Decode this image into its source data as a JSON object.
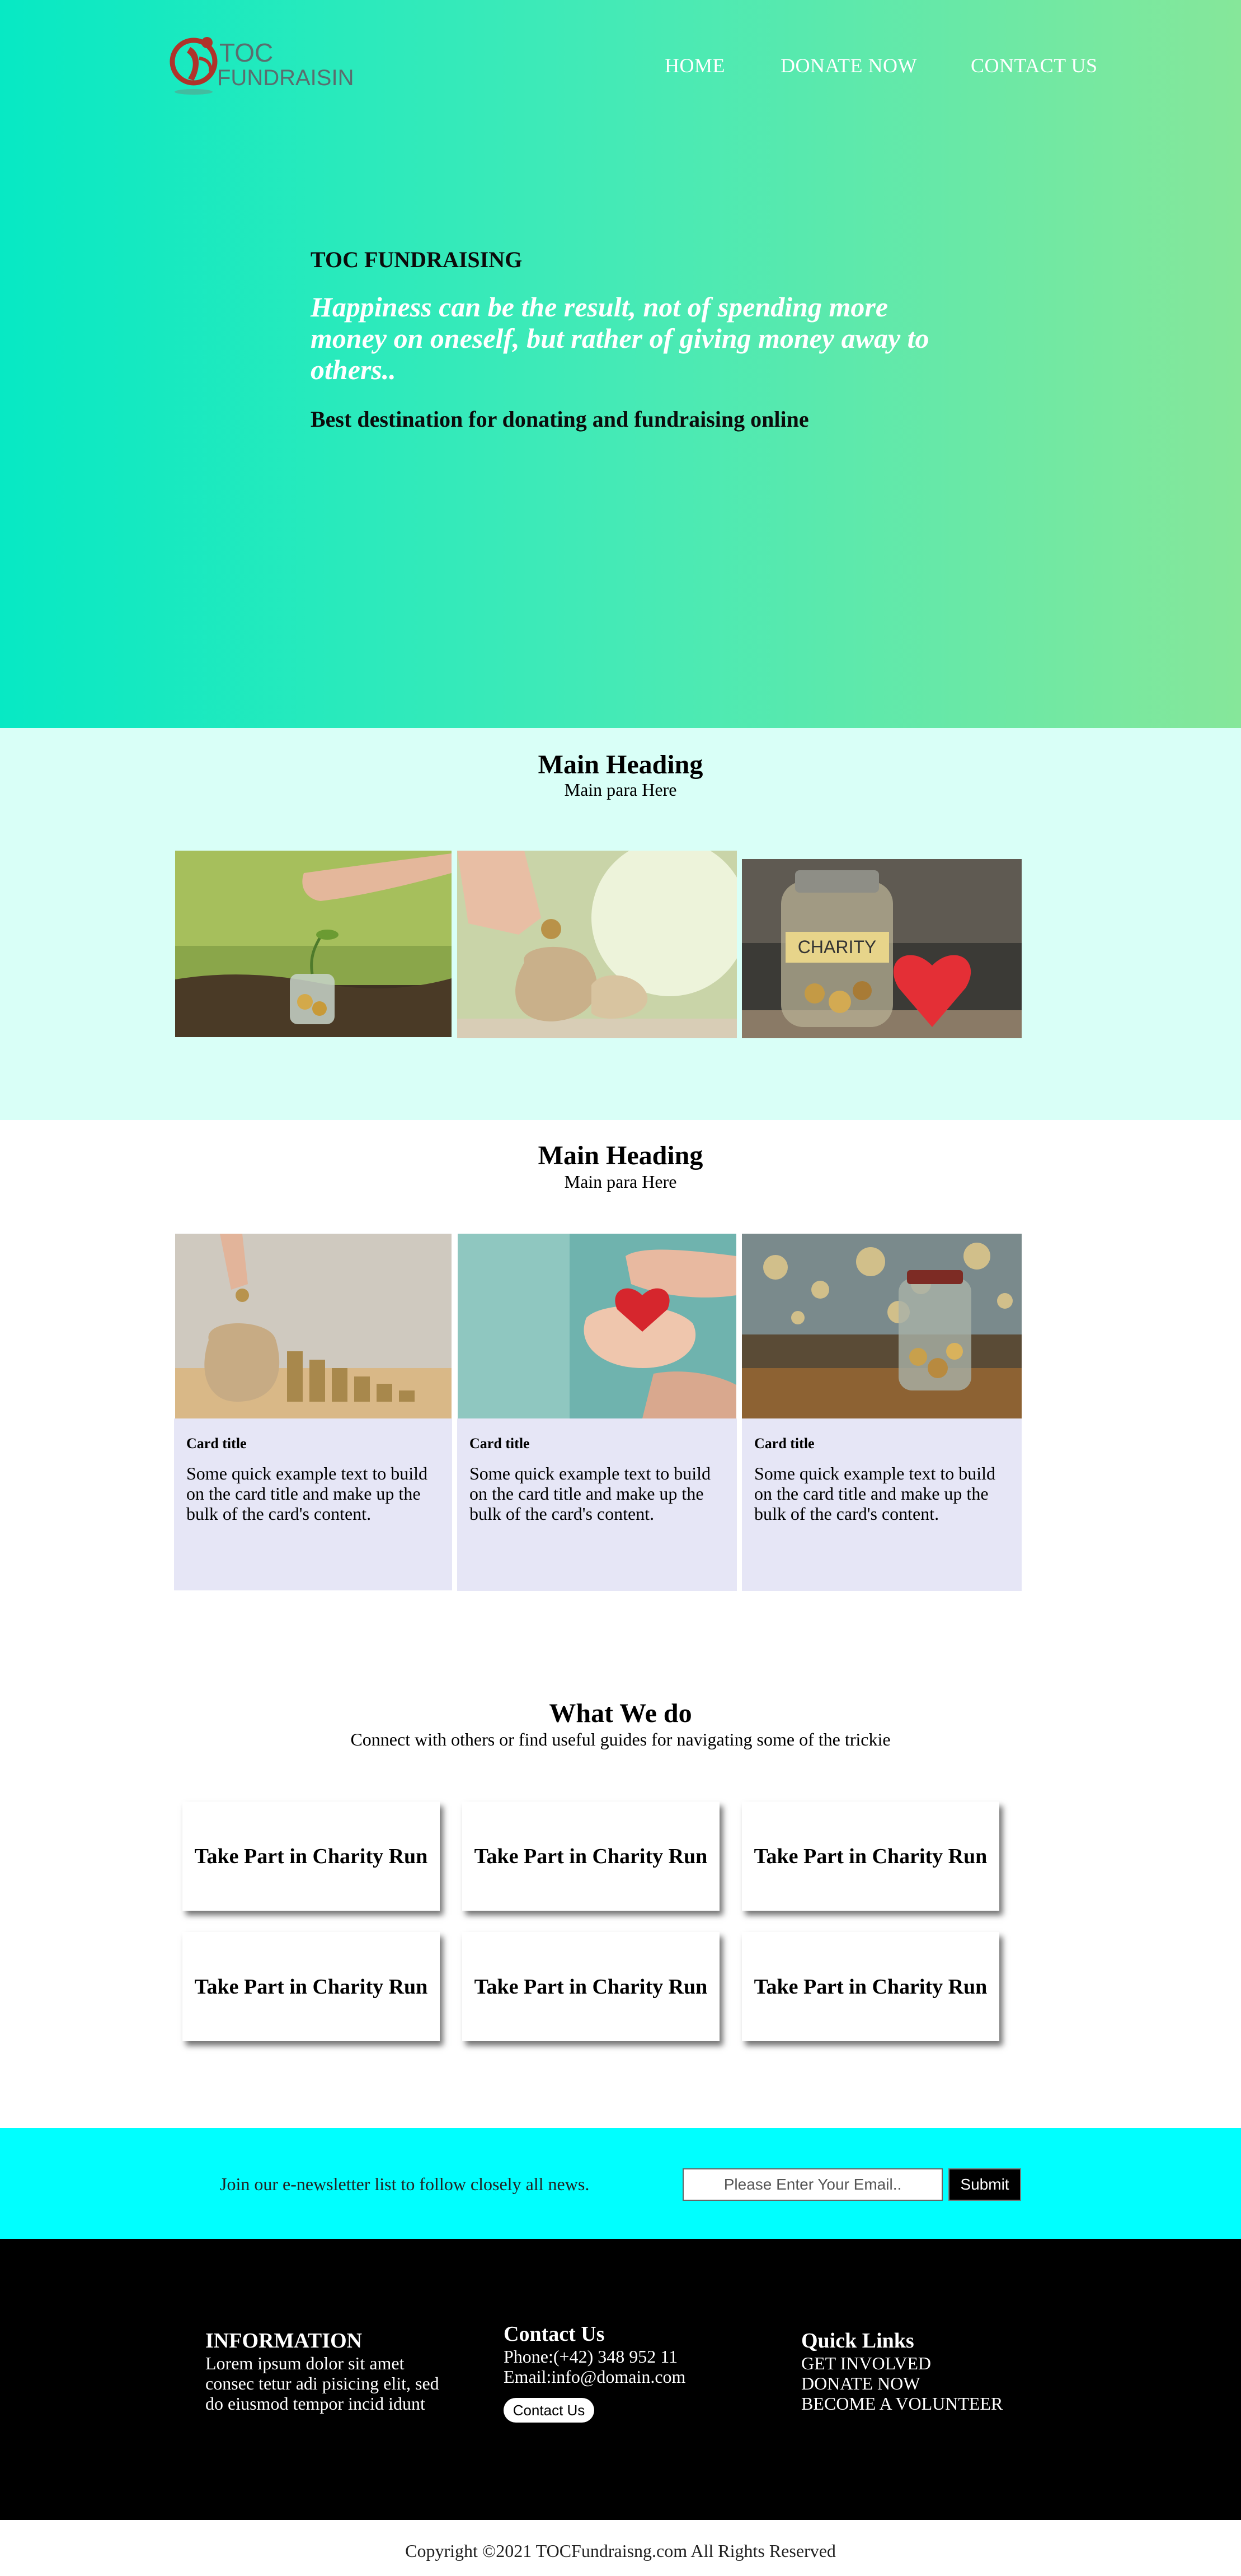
{
  "header": {
    "logo_text": "TOC FUNDRAISING",
    "nav": [
      "HOME",
      "DONATE NOW",
      "CONTACT US"
    ]
  },
  "hero": {
    "brand": "TOC FUNDRAISING",
    "quote": "Happiness can be the result, not of spending more money on oneself, but rather of giving money away to others..",
    "subtitle": "Best destination for donating and fundraising online"
  },
  "section1": {
    "heading": "Main Heading",
    "para": "Main para Here",
    "images": [
      "plant-coins-jar-photo",
      "coin-sack-photo",
      "charity-jar-heart-photo"
    ],
    "jar_label": "CHARITY"
  },
  "section2": {
    "heading": "Main Heading",
    "para": "Main para Here",
    "cards": [
      {
        "title": "Card title",
        "text": "Some quick example text to build on the card title and make up the bulk of the card's content."
      },
      {
        "title": "Card title",
        "text": "Some quick example text to build on the card title and make up the bulk of the card's content."
      },
      {
        "title": "Card title",
        "text": "Some quick example text to build on the card title and make up the bulk of the card's content."
      }
    ]
  },
  "what_we_do": {
    "heading": "What We do",
    "para": "Connect with others or find useful guides for navigating some of the trickie",
    "items": [
      "Take Part in Charity Run",
      "Take Part in Charity Run",
      "Take Part in Charity Run",
      "Take Part in Charity Run",
      "Take Part in Charity Run",
      "Take Part in Charity Run"
    ]
  },
  "newsletter": {
    "text": "Join our e-newsletter list to follow closely all news.",
    "placeholder": "Please Enter Your Email..",
    "submit": "Submit"
  },
  "footer": {
    "info_title": "INFORMATION",
    "info_lines": [
      "Lorem ipsum dolor sit amet",
      "consec tetur adi pisicing elit, sed",
      "do eiusmod tempor incid idunt"
    ],
    "contact_title": "Contact Us",
    "phone": "Phone:(+42) 348 952 11",
    "email": "Email:info@domain.com",
    "contact_button": "Contact Us",
    "links_title": "Quick Links",
    "links": [
      "GET INVOLVED",
      "DONATE NOW",
      "BECOME A VOLUNTEER"
    ]
  },
  "copyright": "Copyright ©2021 TOCFundraisng.com All Rights Reserved",
  "colors": {
    "hero_start": "#07e9c4",
    "hero_end": "#86e79a",
    "section_mint": "#d9fff7",
    "card_bg": "#e6e6f6",
    "newsletter_bg": "#00ffff",
    "footer_bg": "#000000",
    "logo_red": "#c0392b"
  }
}
